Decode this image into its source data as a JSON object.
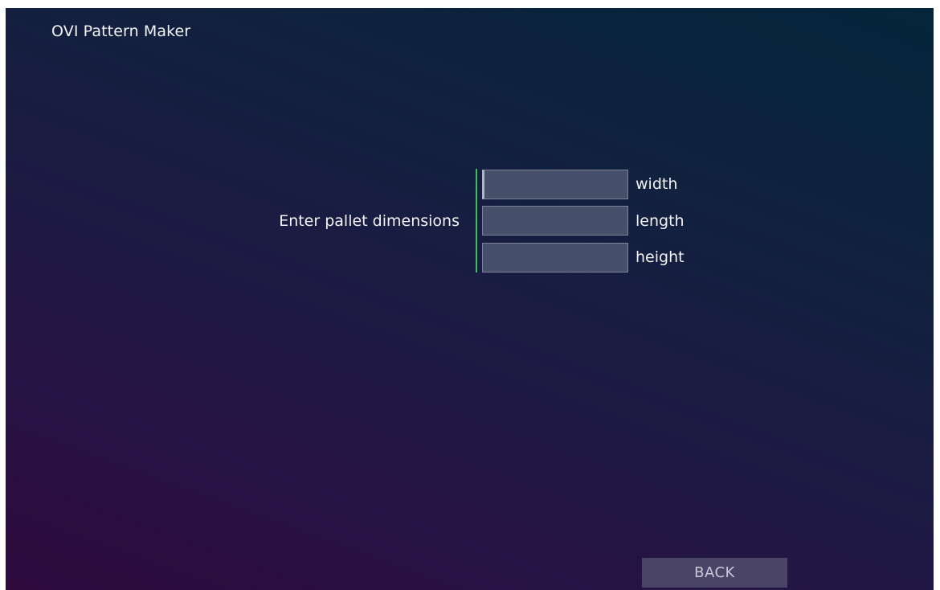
{
  "app": {
    "title": "OVI Pattern Maker"
  },
  "form": {
    "prompt": "Enter pallet dimensions",
    "fields": [
      {
        "value": "",
        "placeholder": "",
        "label": "width"
      },
      {
        "value": "",
        "placeholder": "",
        "label": "length"
      },
      {
        "value": "",
        "placeholder": "",
        "label": "height"
      }
    ]
  },
  "footer": {
    "back_label": "BACK"
  },
  "colors": {
    "accent_line": "#3fbf5a",
    "input_bg": "#46506a",
    "button_bg": "#4a4566"
  }
}
